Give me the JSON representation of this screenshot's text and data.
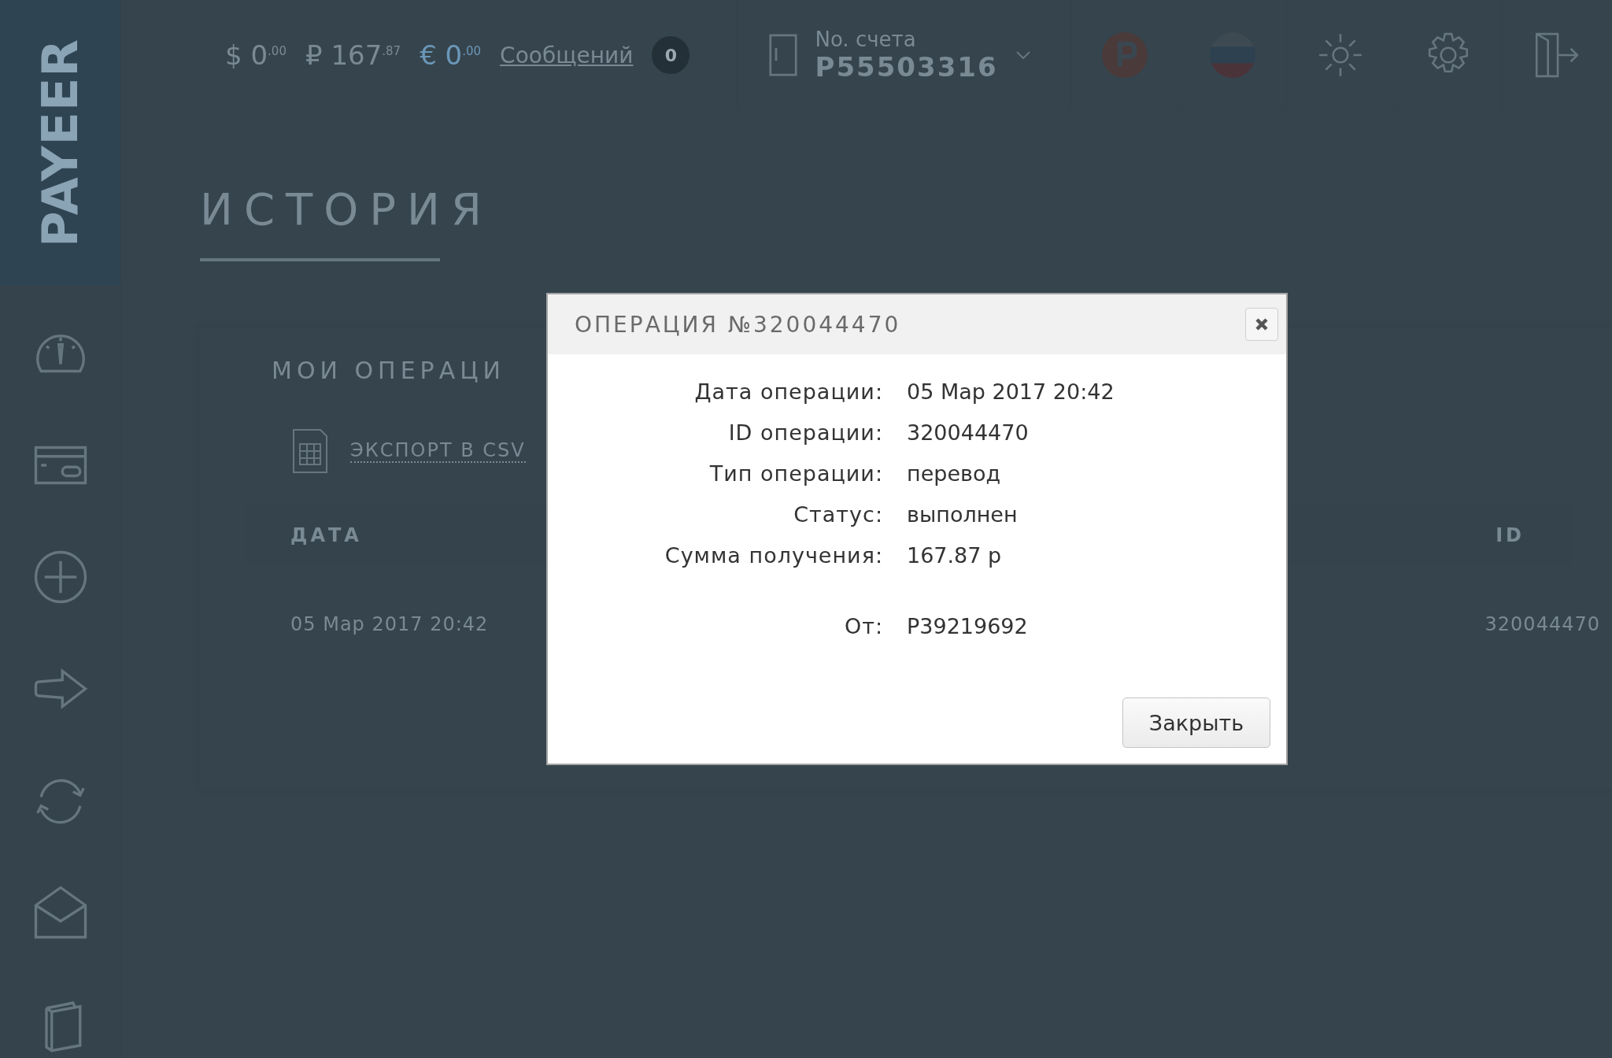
{
  "sidebar": {
    "logo": "PAYEER"
  },
  "topbar": {
    "balances": [
      {
        "symbol": "$",
        "amount": "0",
        "cents": ".00",
        "color": "#7a8a94"
      },
      {
        "symbol": "₽",
        "amount": "167",
        "cents": ".87",
        "color": "#7a8a94"
      },
      {
        "symbol": "€",
        "amount": "0",
        "cents": ".00",
        "color": "#6b97b8"
      }
    ],
    "messages": {
      "label": "Сообщений",
      "count": "0"
    },
    "account": {
      "label": "No. счета",
      "number": "P55503316"
    }
  },
  "page": {
    "title": "ИСТОРИЯ",
    "card_title": "МОИ ОПЕРАЦИ",
    "export_link": "ЭКСПОРТ В CSV",
    "table": {
      "columns": [
        "ДАТА",
        "ID"
      ],
      "rows": [
        [
          "05 Мар 2017 20:42",
          "320044470"
        ]
      ]
    }
  },
  "modal": {
    "title": "ОПЕРАЦИЯ №320044470",
    "field_groups": [
      {
        "fields": [
          {
            "label": "Дата операции:",
            "value": "05 Мар 2017 20:42"
          },
          {
            "label": "ID операции:",
            "value": "320044470"
          },
          {
            "label": "Тип операции:",
            "value": "перевод"
          },
          {
            "label": "Статус:",
            "value": "выполнен"
          },
          {
            "label": "Сумма получения:",
            "value": "167.87 р"
          }
        ]
      },
      {
        "fields": [
          {
            "label": "От:",
            "value": "P39219692"
          }
        ]
      }
    ],
    "button": "Закрыть"
  }
}
